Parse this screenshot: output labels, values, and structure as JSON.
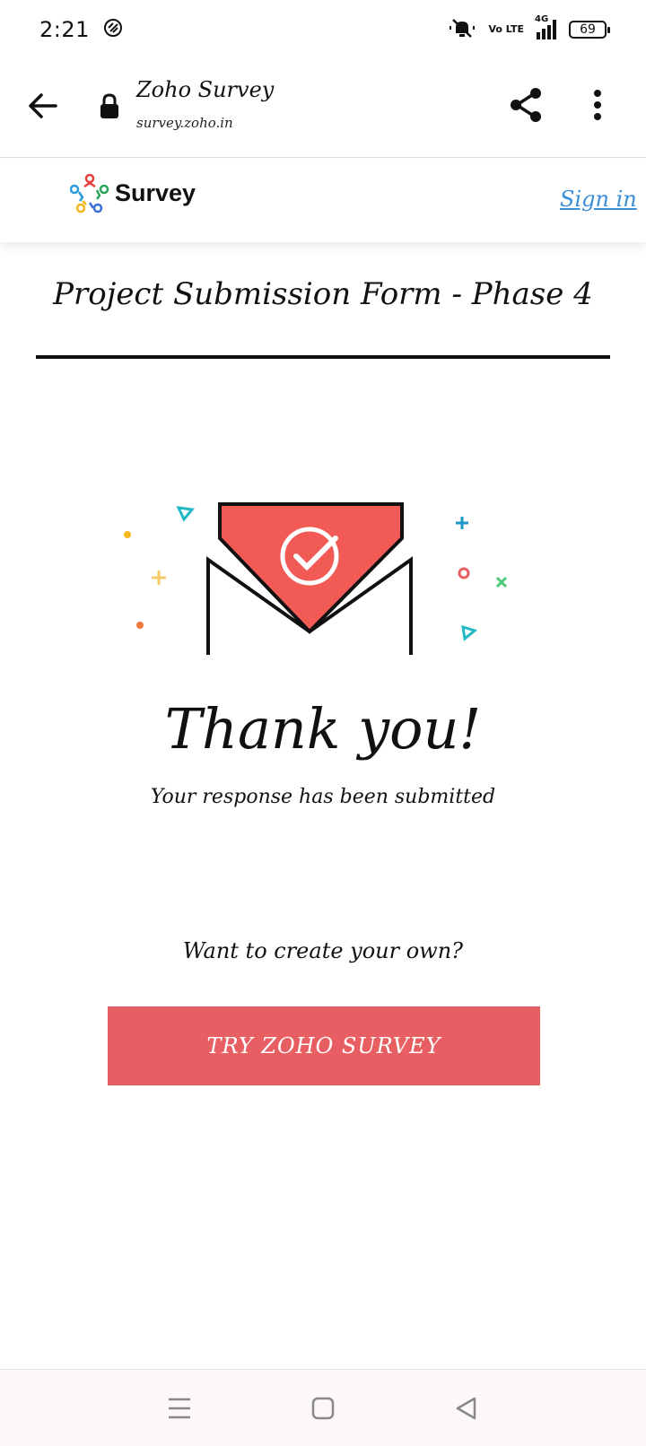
{
  "status": {
    "time": "2:21",
    "network": "4G",
    "volte": "Vo LTE",
    "battery": "69"
  },
  "browser": {
    "title": "Zoho Survey",
    "url": "survey.zoho.in"
  },
  "header": {
    "logo_text": "Survey",
    "signin_label": "Sign in"
  },
  "form": {
    "title": "Project Submission Form - Phase 4"
  },
  "confirmation": {
    "heading": "Thank you!",
    "message": "Your response has been submitted"
  },
  "cta": {
    "prompt": "Want to create your own?",
    "button_label": "TRY ZOHO SURVEY"
  },
  "colors": {
    "accent": "#e85f63",
    "link": "#3b8ed8",
    "envelope_red": "#f25a55"
  }
}
